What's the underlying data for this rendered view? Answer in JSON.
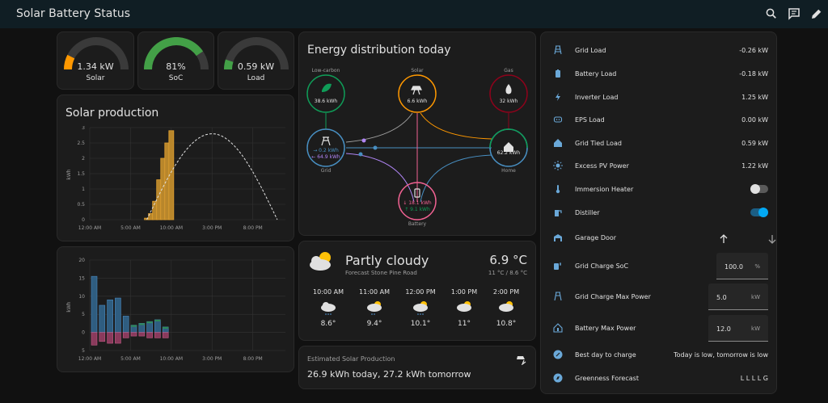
{
  "header": {
    "title": "Solar Battery Status"
  },
  "gauges": [
    {
      "value": "1.34 kW",
      "label": "Solar",
      "fraction": 0.15,
      "color": "#ff9800"
    },
    {
      "value": "81%",
      "label": "SoC",
      "fraction": 0.81,
      "color": "#43a047"
    },
    {
      "value": "0.59 kW",
      "label": "Load",
      "fraction": 0.1,
      "color": "#43a047"
    }
  ],
  "solar_production": {
    "title": "Solar production",
    "ylabel": "kWh"
  },
  "chart_data": [
    {
      "type": "bar",
      "title": "Solar production",
      "ylabel": "kWh",
      "x_ticks": [
        "12:00 AM",
        "5:00 AM",
        "10:00 AM",
        "3:00 PM",
        "8:00 PM"
      ],
      "y_ticks": [
        "0",
        "0.5",
        "1",
        "1.5",
        "2",
        "2.5",
        "3"
      ],
      "ylim": [
        0,
        3
      ],
      "bars_x_hours": [
        7,
        7.5,
        8,
        8.5,
        9,
        9.5,
        10,
        10.5
      ],
      "values": [
        0.05,
        0.2,
        0.6,
        1.3,
        2.0,
        2.5,
        2.9,
        0.0
      ],
      "forecast_line_peak": 2.8,
      "grid": true
    },
    {
      "type": "bar",
      "ylabel": "kWh",
      "x_ticks": [
        "12:00 AM",
        "5:00 AM",
        "10:00 AM",
        "3:00 PM",
        "8:00 PM"
      ],
      "y_ticks": [
        "20",
        "15",
        "10",
        "5",
        "0",
        "5"
      ],
      "ylim": [
        -5,
        20
      ],
      "categories": [
        "0",
        "1",
        "2",
        "3",
        "4",
        "5",
        "6",
        "7",
        "8",
        "9"
      ],
      "series": [
        {
          "values": [
            15.5,
            7.5,
            9.0,
            9.5,
            4.5,
            2.0,
            2.5,
            3.0,
            3.5,
            1.5
          ]
        },
        {
          "values": [
            -3.5,
            -2.5,
            -3.0,
            -3.0,
            -1.5,
            -1.0,
            -1.0,
            -1.5,
            -1.5,
            -1.5
          ]
        }
      ],
      "grid": true
    }
  ],
  "energy": {
    "title": "Energy distribution today",
    "low_carbon_label": "Low-carbon",
    "low_carbon_value": "38.6 kWh",
    "solar_label": "Solar",
    "solar_value": "6.6 kWh",
    "gas_label": "Gas",
    "gas_value": "32 kWh",
    "grid_label": "Grid",
    "grid_in": "→ 0.2 kWh",
    "grid_out": "← 64.9 kWh",
    "home_label": "Home",
    "home_value": "62.2 kWh",
    "battery_label": "Battery",
    "battery_in": "↓ 18.1 kWh",
    "battery_out": "↑ 9.1 kWh"
  },
  "weather": {
    "condition": "Partly cloudy",
    "location": "Forecast Stone Pine Road",
    "temperature": "6.9 °C",
    "range": "11 °C / 8.6 °C",
    "forecast": [
      {
        "time": "10:00 AM",
        "temp": "8.6°"
      },
      {
        "time": "11:00 AM",
        "temp": "9.4°"
      },
      {
        "time": "12:00 PM",
        "temp": "10.1°"
      },
      {
        "time": "1:00 PM",
        "temp": "11°"
      },
      {
        "time": "2:00 PM",
        "temp": "10.8°"
      }
    ]
  },
  "estimate": {
    "title": "Estimated Solar Production",
    "value": "26.9 kWh today, 27.2 kWh tomorrow"
  },
  "entities": {
    "grid_load": {
      "name": "Grid Load",
      "value": "-0.26 kW"
    },
    "battery_load": {
      "name": "Battery Load",
      "value": "-0.18 kW"
    },
    "inverter_load": {
      "name": "Inverter Load",
      "value": "1.25 kW"
    },
    "eps_load": {
      "name": "EPS Load",
      "value": "0.00 kW"
    },
    "grid_tied_load": {
      "name": "Grid Tied Load",
      "value": "0.59 kW"
    },
    "excess_pv": {
      "name": "Excess PV Power",
      "value": "1.22 kW"
    },
    "immersion": {
      "name": "Immersion Heater",
      "state": "off"
    },
    "distiller": {
      "name": "Distiller",
      "state": "on"
    },
    "garage": {
      "name": "Garage Door"
    },
    "grid_charge_soc": {
      "name": "Grid Charge SoC",
      "value": "100.0",
      "unit": "%"
    },
    "grid_charge_max": {
      "name": "Grid Charge Max Power",
      "value": "5.0",
      "unit": "kW"
    },
    "battery_max": {
      "name": "Battery Max Power",
      "value": "12.0",
      "unit": "kW"
    },
    "best_day": {
      "name": "Best day to charge",
      "value": "Today is low, tomorrow is low"
    },
    "greenness": {
      "name": "Greenness Forecast",
      "value": "L L L L G"
    }
  },
  "colors": {
    "accent": "#03a9f4",
    "solar": "#ff9800",
    "grid": "#488fc2",
    "battery": "#f06292",
    "home": "#488fc2",
    "low_carbon": "#0f9d58",
    "gas": "#8e021b"
  }
}
